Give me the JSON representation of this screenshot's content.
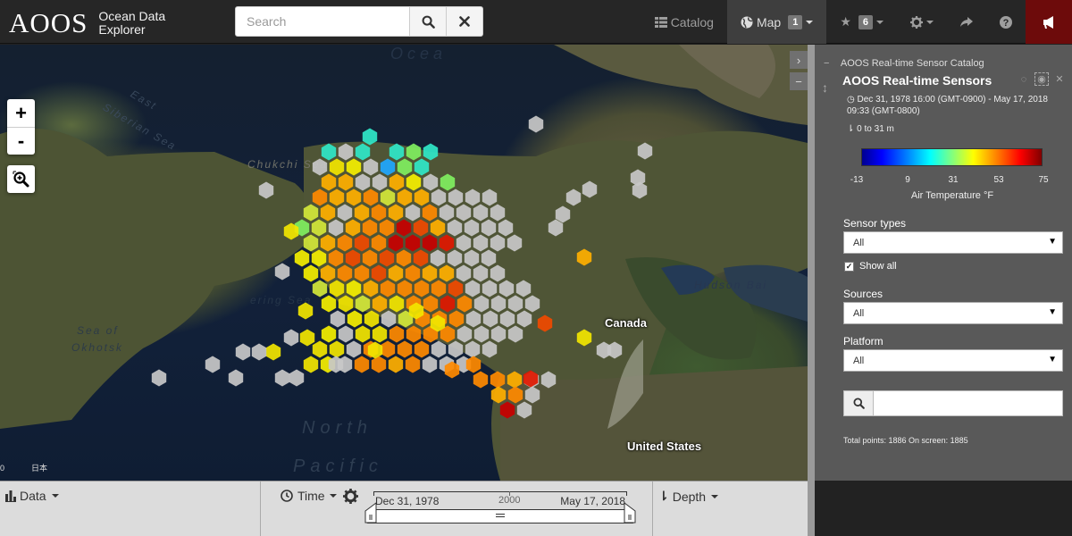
{
  "app": {
    "logo": "AOOS",
    "name_line1": "Ocean Data",
    "name_line2": "Explorer"
  },
  "search": {
    "placeholder": "Search",
    "search_icon": "search-icon",
    "clear_icon": "close-icon"
  },
  "nav": {
    "catalog": {
      "icon": "list-icon",
      "label": "Catalog"
    },
    "map": {
      "icon": "globe-icon",
      "label": "Map",
      "badge": "1"
    },
    "favorites": {
      "icon": "star-icon",
      "badge": "6"
    },
    "settings": {
      "icon": "gear-icon"
    },
    "share": {
      "icon": "share-icon"
    },
    "help": {
      "icon": "question-icon"
    },
    "alert": {
      "icon": "bullhorn-icon"
    }
  },
  "map": {
    "zoom_in": "+",
    "zoom_out": "-",
    "labels": {
      "ocean_top": "Ocea",
      "east_siberian_1": "East",
      "east_siberian_2": "Siberian Sea",
      "chukchi": "Chukchi Sea",
      "bering": "ering Sea",
      "okhotsk_1": "Sea of",
      "okhotsk_2": "Okhotsk",
      "hudson": "Hudson Bai",
      "north": "North",
      "pacific": "Pacific",
      "canada": "Canada",
      "united_states": "United States",
      "attrib_num": "0",
      "attrib_jp": "日本"
    }
  },
  "panel": {
    "catalog_title": "AOOS Real-time Sensor Catalog",
    "layer_title": "AOOS Real-time Sensors",
    "time_range": "Dec 31, 1978 16:00 (GMT-0900) - May 17, 2018 09:33 (GMT-0800)",
    "depth_range": "0 to 31 m",
    "colorbar": {
      "ticks": [
        "-13",
        "9",
        "31",
        "53",
        "75"
      ],
      "label": "Air Temperature °F"
    },
    "sensor_types": {
      "label": "Sensor types",
      "value": "All"
    },
    "show_all": {
      "label": "Show all",
      "checked": true
    },
    "sources": {
      "label": "Sources",
      "value": "All"
    },
    "platform": {
      "label": "Platform",
      "value": "All"
    },
    "filter_placeholder": "",
    "totals": "Total points: 1886 On screen: 1885"
  },
  "bottom": {
    "data_label": "Data",
    "time_label": "Time",
    "depth_label": "Depth",
    "slider_start": "Dec 31, 1978",
    "slider_mid": "2000",
    "slider_end": "May 17, 2018"
  }
}
